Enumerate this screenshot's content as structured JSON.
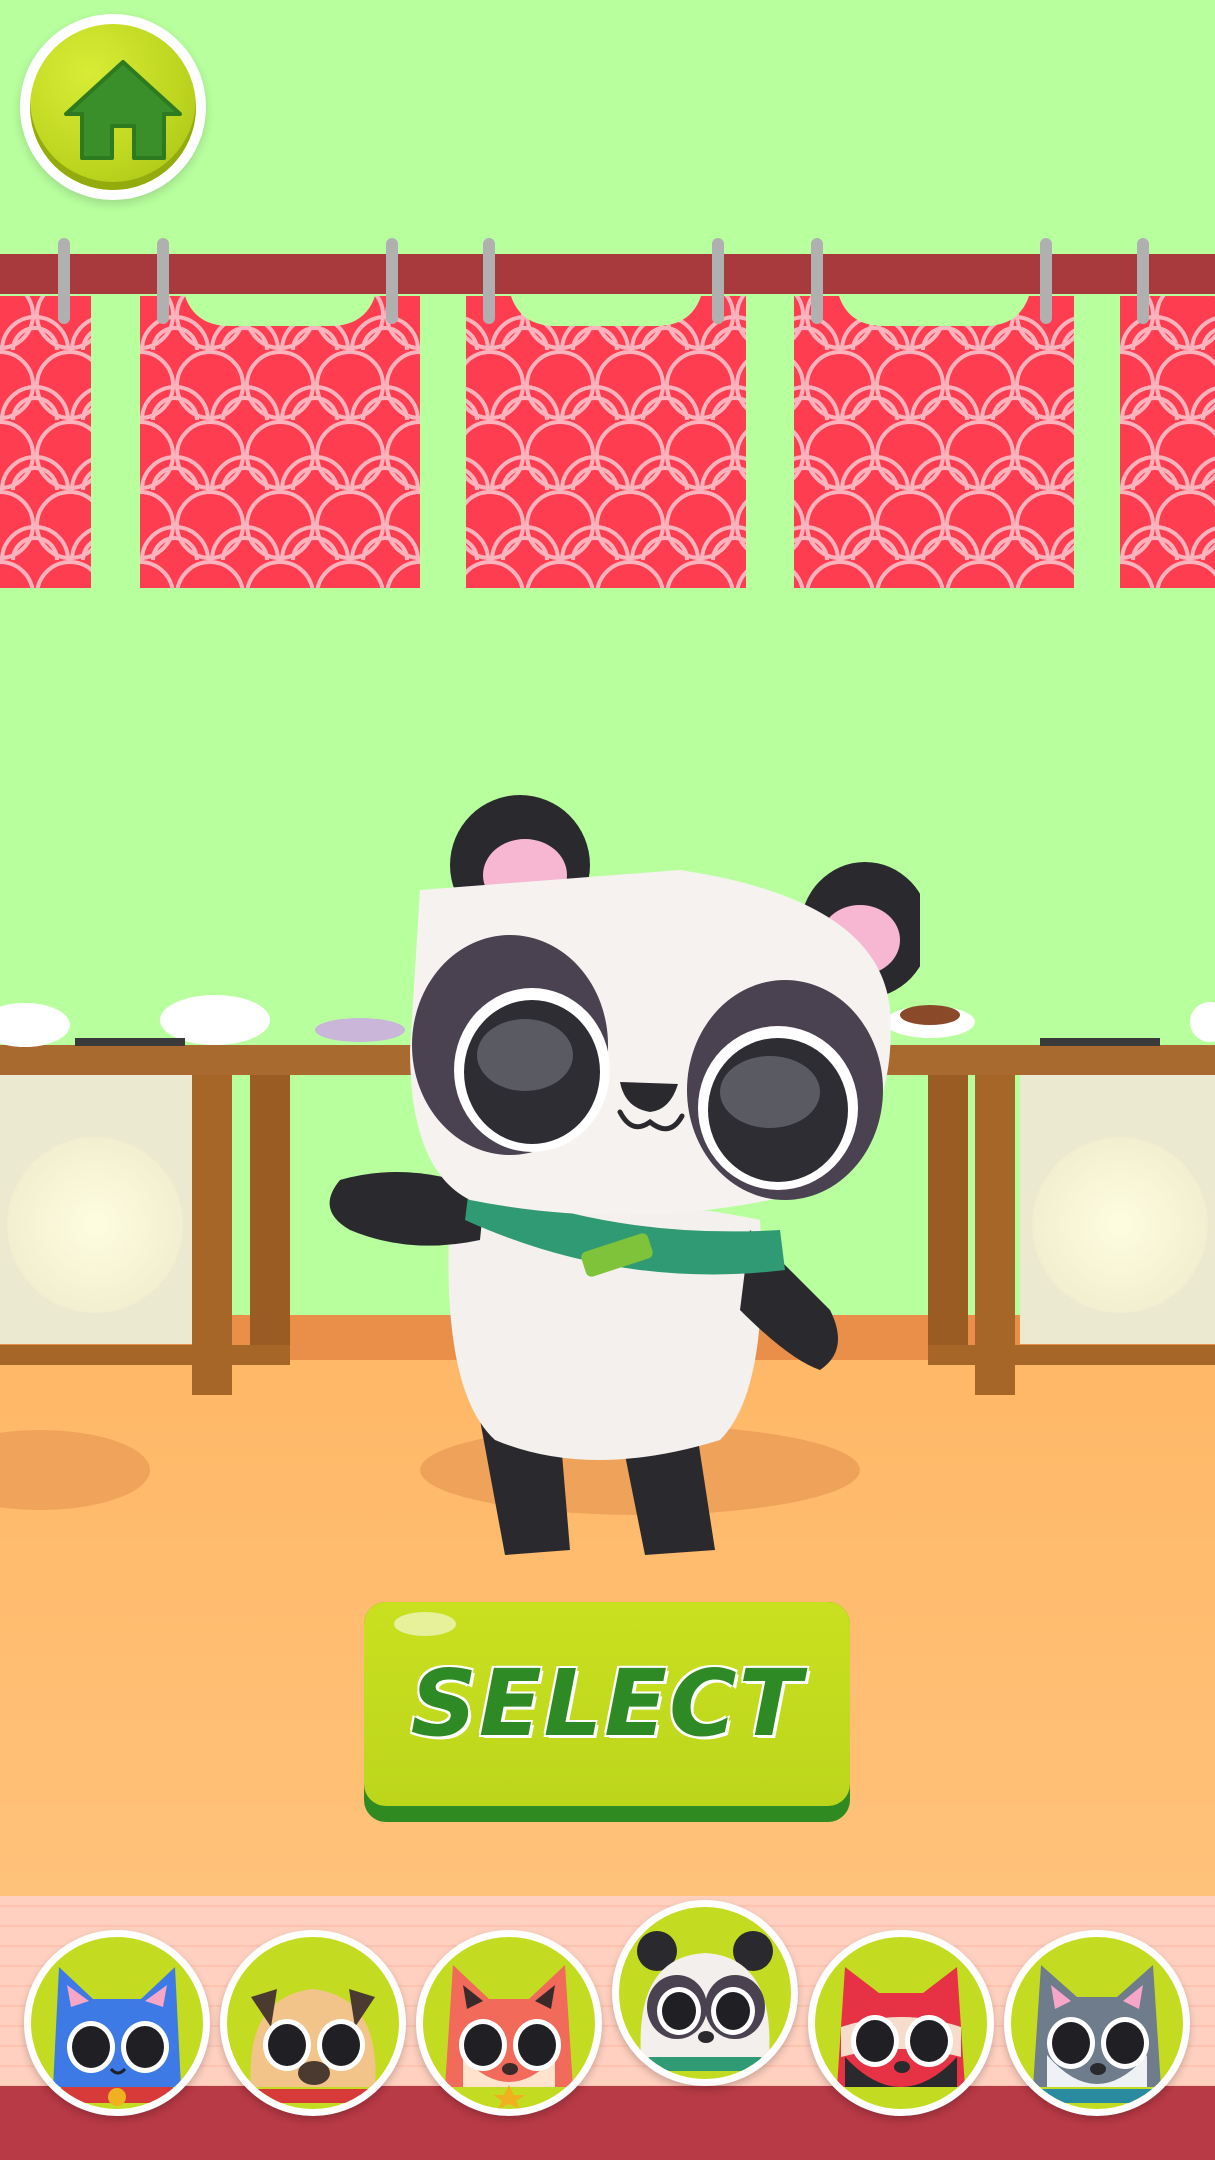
{
  "colors": {
    "sky": "#b8ff9e",
    "banner_red": "#ff3d50",
    "rail": "#a83a3d",
    "floor": "#ffc070",
    "button_green": "#c3dc22",
    "text_green": "#2e8a24"
  },
  "header": {
    "home_button_icon": "home-icon"
  },
  "main": {
    "selected_character": "panda",
    "select_label": "SELECT"
  },
  "character_bar": {
    "selected_index": 3,
    "characters": [
      {
        "name": "blue-cat",
        "icon": "blue-cat-avatar-icon"
      },
      {
        "name": "pug",
        "icon": "pug-avatar-icon"
      },
      {
        "name": "fox",
        "icon": "fox-avatar-icon"
      },
      {
        "name": "panda",
        "icon": "panda-avatar-icon"
      },
      {
        "name": "red-ninja",
        "icon": "ninja-avatar-icon"
      },
      {
        "name": "husky",
        "icon": "husky-avatar-icon"
      }
    ]
  }
}
